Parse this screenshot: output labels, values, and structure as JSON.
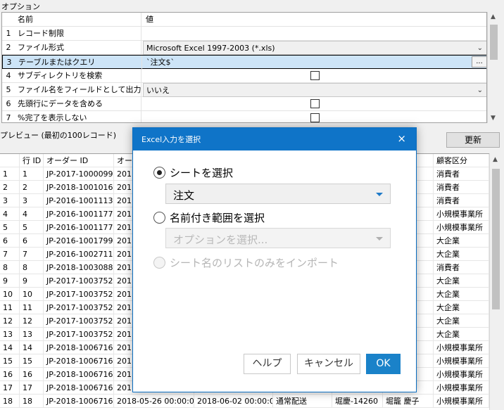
{
  "options": {
    "title": "オプション",
    "header": {
      "name": "名前",
      "value": "値"
    },
    "rows": [
      {
        "num": "1",
        "name": "レコード制限",
        "value": ""
      },
      {
        "num": "2",
        "name": "ファイル形式",
        "value": "Microsoft Excel 1997-2003 (*.xls)"
      },
      {
        "num": "3",
        "name": "テーブルまたはクエリ",
        "value": "`注文$`",
        "button": "..."
      },
      {
        "num": "4",
        "name": "サブディレクトリを検索",
        "value": ""
      },
      {
        "num": "5",
        "name": "ファイル名をフィールドとして出力す...",
        "value": "いいえ"
      },
      {
        "num": "6",
        "name": "先頭行にデータを含める",
        "value": ""
      },
      {
        "num": "7",
        "name": "%完了を表示しない",
        "value": ""
      }
    ]
  },
  "preview": {
    "title": "プレビュー (最初の100レコード)",
    "update_label": "更新",
    "columns": [
      "",
      "行 ID",
      "オーダー ID",
      "オー",
      "",
      "",
      "",
      "",
      "顧客区分"
    ],
    "rows": [
      {
        "n": "1",
        "id": "1",
        "order": "JP-2017-1000099",
        "d1": "201",
        "d2": "",
        "ship": "",
        "cust_id": "",
        "cust": "也",
        "seg": "消費者"
      },
      {
        "n": "2",
        "id": "2",
        "order": "JP-2018-1001016",
        "d1": "201",
        "d2": "",
        "ship": "",
        "cust_id": "",
        "cust": "",
        "seg": "消費者"
      },
      {
        "n": "3",
        "id": "3",
        "order": "JP-2016-1001113",
        "d1": "201",
        "d2": "",
        "ship": "",
        "cust_id": "",
        "cust": "朝",
        "seg": "消費者"
      },
      {
        "n": "4",
        "id": "4",
        "order": "JP-2016-1001177",
        "d1": "201",
        "d2": "",
        "ship": "",
        "cust_id": "",
        "cust": "ト",
        "seg": "小規模事業所"
      },
      {
        "n": "5",
        "id": "5",
        "order": "JP-2016-1001177",
        "d1": "201",
        "d2": "",
        "ship": "",
        "cust_id": "",
        "cust": "ト",
        "seg": "小規模事業所"
      },
      {
        "n": "6",
        "id": "6",
        "order": "JP-2016-1001799",
        "d1": "201",
        "d2": "",
        "ship": "",
        "cust_id": "",
        "cust": "",
        "seg": "大企業"
      },
      {
        "n": "7",
        "id": "7",
        "order": "JP-2016-1002711",
        "d1": "201",
        "d2": "",
        "ship": "",
        "cust_id": "",
        "cust": "美月",
        "seg": "大企業"
      },
      {
        "n": "8",
        "id": "8",
        "order": "JP-2018-1003088",
        "d1": "201",
        "d2": "",
        "ship": "",
        "cust_id": "",
        "cust": "",
        "seg": "消費者"
      },
      {
        "n": "9",
        "id": "9",
        "order": "JP-2017-1003752",
        "d1": "201",
        "d2": "",
        "ship": "",
        "cust_id": "",
        "cust": "康",
        "seg": "大企業"
      },
      {
        "n": "10",
        "id": "10",
        "order": "JP-2017-1003752",
        "d1": "201",
        "d2": "",
        "ship": "",
        "cust_id": "",
        "cust": "康",
        "seg": "大企業"
      },
      {
        "n": "11",
        "id": "11",
        "order": "JP-2017-1003752",
        "d1": "201",
        "d2": "",
        "ship": "",
        "cust_id": "",
        "cust": "康",
        "seg": "大企業"
      },
      {
        "n": "12",
        "id": "12",
        "order": "JP-2017-1003752",
        "d1": "201",
        "d2": "",
        "ship": "",
        "cust_id": "",
        "cust": "康",
        "seg": "大企業"
      },
      {
        "n": "13",
        "id": "13",
        "order": "JP-2017-1003752",
        "d1": "201",
        "d2": "",
        "ship": "",
        "cust_id": "",
        "cust": "康",
        "seg": "大企業"
      },
      {
        "n": "14",
        "id": "14",
        "order": "JP-2018-1006716",
        "d1": "201",
        "d2": "",
        "ship": "",
        "cust_id": "",
        "cust": "子",
        "seg": "小規模事業所"
      },
      {
        "n": "15",
        "id": "15",
        "order": "JP-2018-1006716",
        "d1": "201",
        "d2": "",
        "ship": "",
        "cust_id": "",
        "cust": "子",
        "seg": "小規模事業所"
      },
      {
        "n": "16",
        "id": "16",
        "order": "JP-2018-1006716",
        "d1": "201",
        "d2": "",
        "ship": "",
        "cust_id": "",
        "cust": "子",
        "seg": "小規模事業所"
      },
      {
        "n": "17",
        "id": "17",
        "order": "JP-2018-1006716",
        "d1": "201",
        "d2": "",
        "ship": "",
        "cust_id": "",
        "cust": "子",
        "seg": "小規模事業所"
      },
      {
        "n": "18",
        "id": "18",
        "order": "JP-2018-1006716",
        "d1": "2018-05-26 00:00:00",
        "d2": "2018-06-02 00:00:00",
        "ship": "通常配送",
        "cust_id": "堀慶-14260",
        "cust": "堀籠 慶子",
        "seg": "小規模事業所"
      }
    ]
  },
  "dialog": {
    "title": "Excel入力を選択",
    "close": "×",
    "option_sheet": "シートを選択",
    "sheet_value": "注文",
    "option_range": "名前付き範囲を選択",
    "range_placeholder": "オプションを選択...",
    "option_list": "シート名のリストのみをインポート",
    "help_label": "ヘルプ",
    "cancel_label": "キャンセル",
    "ok_label": "OK"
  },
  "colors": {
    "accent": "#0f74c8",
    "selected_row": "#cde4f7",
    "ok_button": "#1a82c9"
  }
}
